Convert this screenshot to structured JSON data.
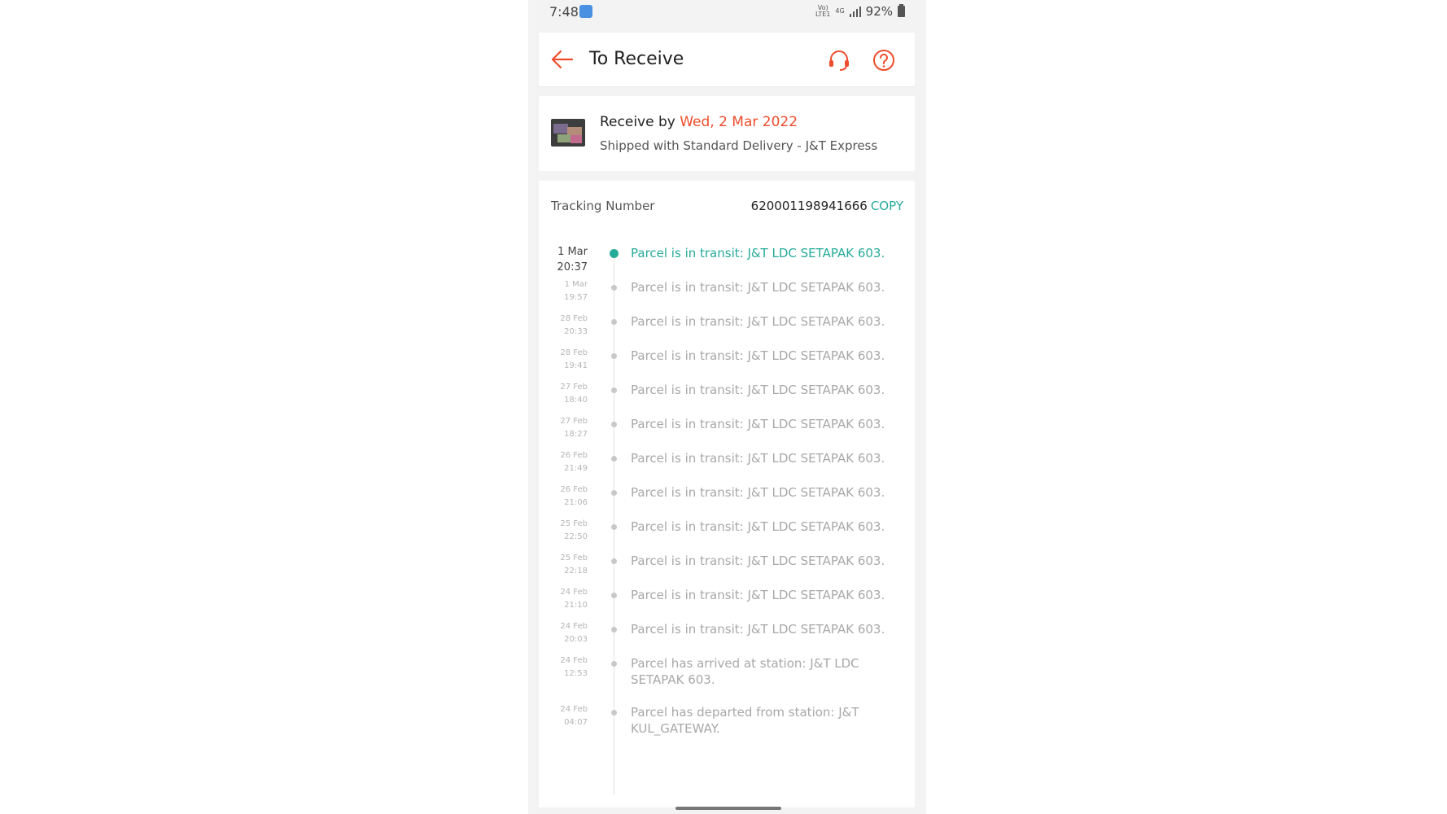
{
  "status_bar": {
    "time": "7:48",
    "network_top": "Vo)",
    "network_bottom": "LTE1",
    "network_type": "4G",
    "battery": "92%"
  },
  "header": {
    "title": "To Receive",
    "icons": {
      "back": "back-arrow-icon",
      "support": "headset-icon",
      "help": "help-circle-icon"
    }
  },
  "receive": {
    "label": "Receive by",
    "date": "Wed, 2 Mar 2022",
    "shipping": "Shipped with Standard Delivery - J&T Express"
  },
  "tracking": {
    "label": "Tracking Number",
    "number": "620001198941666",
    "copy_label": "COPY"
  },
  "events": [
    {
      "date": "1 Mar",
      "time": "20:37",
      "text": "Parcel is in transit: J&T LDC SETAPAK 603."
    },
    {
      "date": "1 Mar",
      "time": "19:57",
      "text": "Parcel is in transit: J&T LDC SETAPAK 603."
    },
    {
      "date": "28 Feb",
      "time": "20:33",
      "text": "Parcel is in transit: J&T LDC SETAPAK 603."
    },
    {
      "date": "28 Feb",
      "time": "19:41",
      "text": "Parcel is in transit: J&T LDC SETAPAK 603."
    },
    {
      "date": "27 Feb",
      "time": "18:40",
      "text": "Parcel is in transit: J&T LDC SETAPAK 603."
    },
    {
      "date": "27 Feb",
      "time": "18:27",
      "text": "Parcel is in transit: J&T LDC SETAPAK 603."
    },
    {
      "date": "26 Feb",
      "time": "21:49",
      "text": "Parcel is in transit: J&T LDC SETAPAK 603."
    },
    {
      "date": "26 Feb",
      "time": "21:06",
      "text": "Parcel is in transit: J&T LDC SETAPAK 603."
    },
    {
      "date": "25 Feb",
      "time": "22:50",
      "text": "Parcel is in transit: J&T LDC SETAPAK 603."
    },
    {
      "date": "25 Feb",
      "time": "22:18",
      "text": "Parcel is in transit: J&T LDC SETAPAK 603."
    },
    {
      "date": "24 Feb",
      "time": "21:10",
      "text": "Parcel is in transit: J&T LDC SETAPAK 603."
    },
    {
      "date": "24 Feb",
      "time": "20:03",
      "text": "Parcel is in transit: J&T LDC SETAPAK 603."
    },
    {
      "date": "24 Feb",
      "time": "12:53",
      "text": "Parcel has arrived at station: J&T LDC SETAPAK 603."
    },
    {
      "date": "24 Feb",
      "time": "04:07",
      "text": "Parcel has departed from station: J&T KUL_GATEWAY."
    }
  ],
  "colors": {
    "accent": "#ee4d2d",
    "success": "#26aa99"
  }
}
